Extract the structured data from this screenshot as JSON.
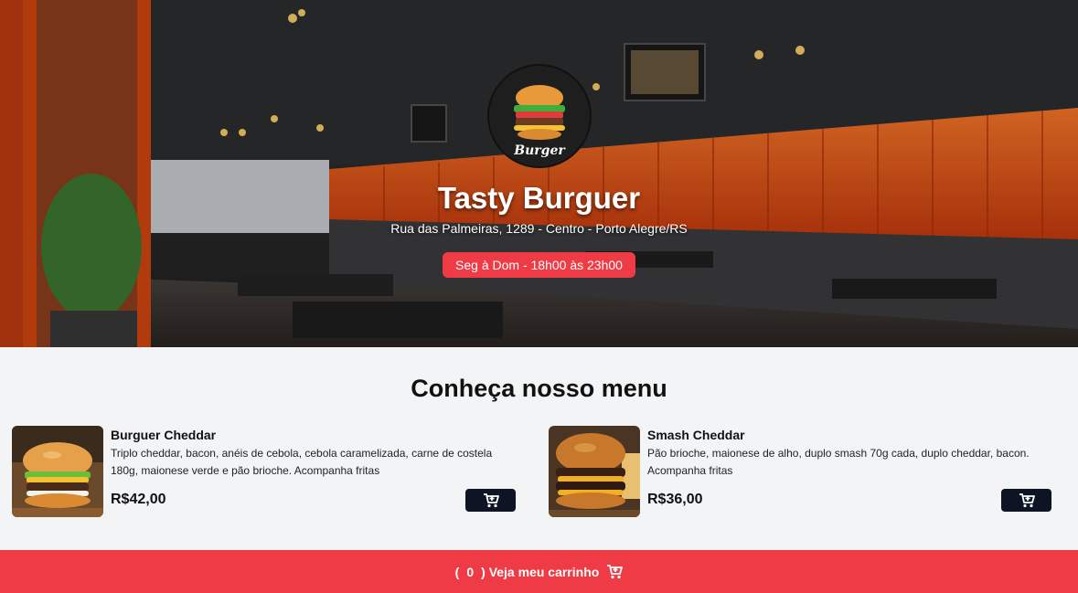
{
  "hero": {
    "title": "Tasty Burguer",
    "address": "Rua das Palmeiras, 1289 - Centro - Porto Alegre/RS",
    "hours": "Seg à Dom - 18h00 às 23h00",
    "logo_text": "Burger"
  },
  "menu": {
    "title": "Conheça nosso menu",
    "items": [
      {
        "name": "Burguer Cheddar",
        "description": "Triplo cheddar, bacon, anéis de cebola, cebola caramelizada, carne de costela 180g, maionese verde e pão brioche. Acompanha fritas",
        "price": "R$42,00",
        "icon": "cart-plus-icon"
      },
      {
        "name": "Smash Cheddar",
        "description": "Pão brioche, maionese de alho, duplo smash 70g cada, duplo cheddar, bacon. Acompanha fritas",
        "price": "R$36,00",
        "icon": "cart-plus-icon"
      }
    ]
  },
  "footer": {
    "open_paren": "(",
    "count": "0",
    "close_label": ") Veja meu carrinho",
    "icon": "cart-icon"
  },
  "colors": {
    "accent": "#ef3b46",
    "button_dark": "#0d1423",
    "background": "#f3f4f6"
  }
}
